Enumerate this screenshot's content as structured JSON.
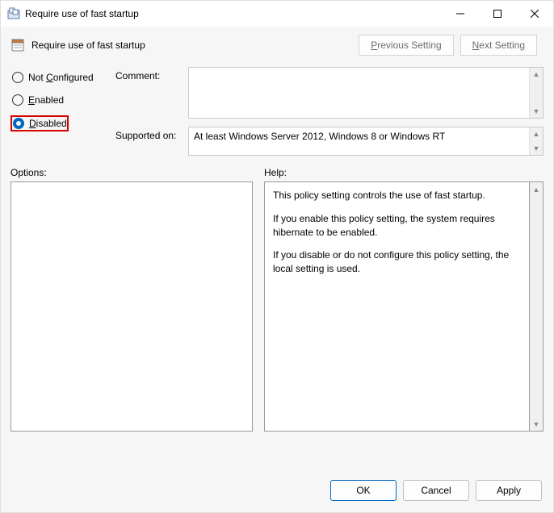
{
  "window": {
    "title": "Require use of fast startup"
  },
  "subheader": {
    "title": "Require use of fast startup"
  },
  "nav": {
    "previous_p": "P",
    "previous_rest": "revious Setting",
    "next_n": "N",
    "next_rest": "ext Setting"
  },
  "radios": {
    "not_configured_c": "C",
    "not_configured_pre": "Not ",
    "not_configured_post": "onfigured",
    "enabled_e": "E",
    "enabled_rest": "nabled",
    "disabled_d": "D",
    "disabled_rest": "isabled"
  },
  "fields": {
    "comment_label": "Comment:",
    "comment_value": "",
    "supported_label": "Supported on:",
    "supported_value": "At least Windows Server 2012, Windows 8 or Windows RT"
  },
  "panels": {
    "options_label": "Options:",
    "help_label": "Help:"
  },
  "help": {
    "p1": "This policy setting controls the use of fast startup.",
    "p2": "If you enable this policy setting, the system requires hibernate to be enabled.",
    "p3": "If you disable or do not configure this policy setting, the local setting is used."
  },
  "footer": {
    "ok": "OK",
    "cancel": "Cancel",
    "apply": "Apply"
  }
}
